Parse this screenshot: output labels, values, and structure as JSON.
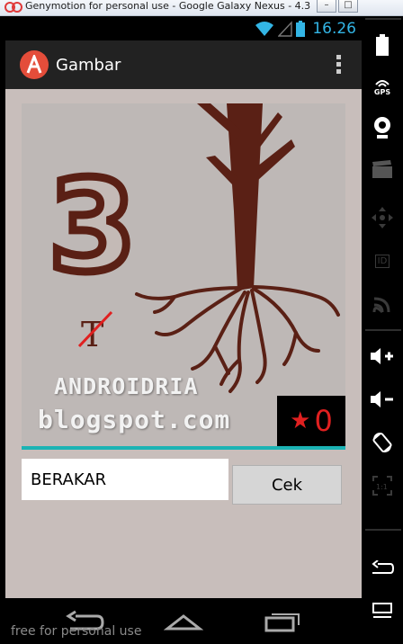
{
  "window": {
    "title": "Genymotion for personal use - Google Galaxy Nexus - 4.3 ...",
    "minimize": "–",
    "maximize": "□"
  },
  "status_bar": {
    "time": "16.26",
    "accent": "#33b5e5"
  },
  "action_bar": {
    "app_title": "Gambar",
    "app_icon": "letter-a-icon",
    "overflow_icon": "overflow-menu-icon"
  },
  "puzzle": {
    "number": "3",
    "struck_letter": "T",
    "brand_line1": "ANDROIDRIA",
    "brand_line2": "blogspot.com",
    "score": "0",
    "score_icon": "star-icon"
  },
  "answer": {
    "value": "BERAKAR",
    "check_label": "Cek"
  },
  "nav": {
    "back": "back-icon",
    "home": "home-icon",
    "recents": "recents-icon"
  },
  "watermark": "free for personal use",
  "side_toolbar": {
    "gps_label": "GPS",
    "id_label": "ID",
    "scale_label": "1:1"
  },
  "colors": {
    "content_bg": "#c8bebb",
    "accent_line": "#1bb3b4",
    "tree": "#5a2015",
    "score": "#e02020"
  }
}
